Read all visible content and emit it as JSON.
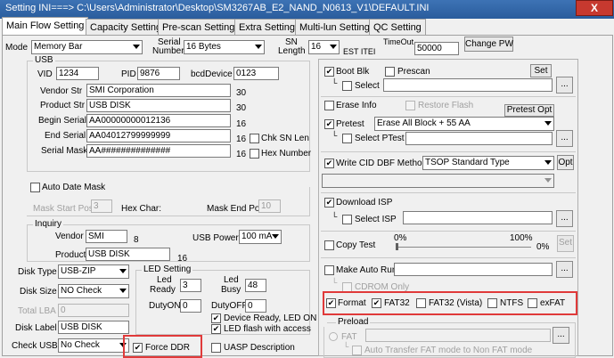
{
  "window": {
    "title": "Setting  INI===> C:\\Users\\Administrator\\Desktop\\SM3267AB_E2_NAND_N0613_V1\\DEFAULT.INI",
    "close": "X"
  },
  "tabs": [
    "Main Flow Setting",
    "Capacity Setting",
    "Pre-scan Setting",
    "Extra Setting",
    "Multi-lun Setting",
    "QC Setting"
  ],
  "top": {
    "mode_label": "Mode",
    "mode_value": "Memory Bar",
    "serial_label1": "Serial",
    "serial_label2": "Number",
    "serial_value": "16 Bytes",
    "sn_label1": "SN",
    "sn_label2": "Length",
    "sn_value": "16",
    "test_item": "EST ITEI",
    "timeout_label": "TimeOut",
    "timeout_value": "50000",
    "change_pw": "Change PW"
  },
  "usb": {
    "group": "USB",
    "vid_label": "VID",
    "vid": "1234",
    "pid_label": "PID",
    "pid": "9876",
    "bcd_label": "bcdDevice",
    "bcd": "0123",
    "vendor_label": "Vendor Str",
    "vendor": "SMI Corporation",
    "vendor_len": "30",
    "product_label": "Product Str",
    "product": "USB DISK",
    "product_len": "30",
    "begin_label": "Begin Serial",
    "begin": "AA00000000012136",
    "begin_len": "16",
    "end_label": "End Serial",
    "end": "AA04012799999999",
    "end_len": "16",
    "mask_label": "Serial Mask",
    "mask": "AA##############",
    "mask_len": "16",
    "chk_sn_len": "Chk SN Len",
    "hex_number": "Hex Number"
  },
  "auto_date": {
    "group": "Auto Date Mask",
    "start_label": "Mask Start Pos:",
    "start": "3",
    "hex_label": "Hex Char:",
    "end_label": "Mask End Pos:",
    "end": "10"
  },
  "inquiry": {
    "group": "Inquiry",
    "vendor_label": "Vendor",
    "vendor": "SMI",
    "vendor_len": "8",
    "product_label": "Product",
    "product": "USB DISK",
    "product_len": "16",
    "usb_power_label": "USB Power",
    "usb_power": "100 mA"
  },
  "disk": {
    "type_label": "Disk Type",
    "type": "USB-ZIP",
    "size_label": "Disk Size",
    "size": "NO Check",
    "lba_label": "Total LBA",
    "lba": "0",
    "label_label": "Disk Label",
    "label": "USB DISK",
    "check_label": "Check USB",
    "check": "No Check"
  },
  "led": {
    "group": "LED Setting",
    "ready_label1": "Led",
    "ready_label2": "Ready",
    "ready": "3",
    "busy_label1": "Led",
    "busy_label2": "Busy",
    "busy": "48",
    "dutyon_label": "DutyON",
    "dutyon": "0",
    "dutyoff_label": "DutyOFF",
    "dutyoff": "0",
    "ready_on": "Device Ready, LED ON",
    "flash_access": "LED flash with access"
  },
  "bottom": {
    "force_ddr": "Force DDR",
    "uasp": "UASP Description"
  },
  "right": {
    "boot_blk": "Boot Blk",
    "prescan": "Prescan",
    "set": "Set",
    "select": "Select",
    "erase_info": "Erase Info",
    "restore_flash": "Restore Flash",
    "pretest_opt": "Pretest Opt",
    "pretest": "Pretest",
    "pretest_value": "Erase All Block + 55 AA",
    "select_ptest": "Select PTest",
    "write_cid": "Write CID",
    "dbf_method": "DBF Method",
    "dbf_value": "TSOP Standard Type",
    "opt": "Opt",
    "download_isp": "Download ISP",
    "select_isp": "Select ISP",
    "copy_test": "Copy Test",
    "pct0": "0%",
    "pct100": "100%",
    "pct_val": "0%",
    "set2": "Set",
    "make_auto_run": "Make Auto Run",
    "cdrom_only": "CDROM Only",
    "format": "Format",
    "fat32": "FAT32",
    "fat32_vista": "FAT32 (Vista)",
    "ntfs": "NTFS",
    "exfat": "exFAT",
    "preload": "Preload",
    "fat": "FAT",
    "auto_transfer": "Auto Transfer FAT mode to Non FAT mode",
    "browse": "..."
  },
  "colors": {
    "highlight": "#e03a3a",
    "titlebar": "#2f63a8"
  }
}
